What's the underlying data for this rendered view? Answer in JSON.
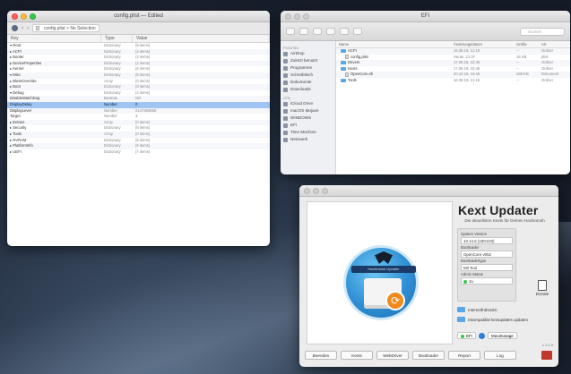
{
  "plist": {
    "title": "config.plist — Edited",
    "path": "config.plist  >  No Selection",
    "columns": [
      "Key",
      "Type",
      "Value"
    ],
    "rows": [
      {
        "key": "▾ Root",
        "type": "Dictionary",
        "value": "(9 items)"
      },
      {
        "key": "   ▸ ACPI",
        "type": "Dictionary",
        "value": "(4 items)"
      },
      {
        "key": "   ▸ Booter",
        "type": "Dictionary",
        "value": "(3 items)"
      },
      {
        "key": "   ▸ DeviceProperties",
        "type": "Dictionary",
        "value": "(2 items)"
      },
      {
        "key": "   ▸ Kernel",
        "type": "Dictionary",
        "value": "(6 items)"
      },
      {
        "key": "   ▾ Misc",
        "type": "Dictionary",
        "value": "(6 items)"
      },
      {
        "key": "      ▸ BlessOverride",
        "type": "Array",
        "value": "(0 items)"
      },
      {
        "key": "      ▸ Boot",
        "type": "Dictionary",
        "value": "(9 items)"
      },
      {
        "key": "      ▾ Debug",
        "type": "Dictionary",
        "value": "(4 items)"
      },
      {
        "key": "         DisableWatchDog",
        "type": "Boolean",
        "value": "NO"
      },
      {
        "key": "         DisplayDelay",
        "type": "Number",
        "value": "0"
      },
      {
        "key": "         DisplayLevel",
        "type": "Number",
        "value": "2147483650"
      },
      {
        "key": "         Target",
        "type": "Number",
        "value": "3"
      },
      {
        "key": "      ▸ Entries",
        "type": "Array",
        "value": "(0 items)"
      },
      {
        "key": "      ▸ Security",
        "type": "Dictionary",
        "value": "(8 items)"
      },
      {
        "key": "      ▸ Tools",
        "type": "Array",
        "value": "(0 items)"
      },
      {
        "key": "   ▸ NVRAM",
        "type": "Dictionary",
        "value": "(6 items)"
      },
      {
        "key": "   ▸ PlatformInfo",
        "type": "Dictionary",
        "value": "(6 items)"
      },
      {
        "key": "   ▸ UEFI",
        "type": "Dictionary",
        "value": "(7 items)"
      }
    ],
    "selected_index": 10
  },
  "finder": {
    "title": "EFI",
    "search_placeholder": "Suchen",
    "sidebar": [
      {
        "header": "Favoriten",
        "items": [
          "AirDrop",
          "Zuletzt benutzt",
          "Programme",
          "Schreibtisch",
          "Dokumente",
          "Downloads"
        ]
      },
      {
        "header": "Orte",
        "items": [
          "iCloud Drive",
          "macOS Mojave",
          "WINDOWS",
          "EFI",
          "Time Machine",
          "Netzwerk"
        ]
      }
    ],
    "columns": [
      "Name",
      "Änderungsdatum",
      "Größe",
      "Art"
    ],
    "rows": [
      {
        "name": "ACPI",
        "date": "16.08.19, 21:19",
        "size": "--",
        "kind": "Ordner",
        "folder": true,
        "indent": 1
      },
      {
        "name": "config.plist",
        "date": "Heute, 21:37",
        "size": "16 KB",
        "kind": "plist",
        "folder": false,
        "indent": 2
      },
      {
        "name": "Drivers",
        "date": "17.08.19, 22:46",
        "size": "--",
        "kind": "Ordner",
        "folder": true,
        "indent": 1
      },
      {
        "name": "Kexts",
        "date": "17.08.19, 22:46",
        "size": "--",
        "kind": "Ordner",
        "folder": true,
        "indent": 1
      },
      {
        "name": "OpenCore.efi",
        "date": "20.10.19, 16:49",
        "size": "268 KB",
        "kind": "Dokument",
        "folder": false,
        "indent": 2
      },
      {
        "name": "Tools",
        "date": "16.08.19, 21:19",
        "size": "--",
        "kind": "Ordner",
        "folder": true,
        "indent": 1
      }
    ]
  },
  "kext": {
    "title": "Kext Updater",
    "subtitle": "Die aktuellsten Kexts für Deinen Hackintosh",
    "logo_banner": "Hackintosh Updater",
    "info": [
      {
        "label": "System Version",
        "value": "10.14.6 (18G103)"
      },
      {
        "label": "Bootloader",
        "value": "OpenCore v052"
      },
      {
        "label": "Bootloadertype",
        "value": "Mit Tool"
      },
      {
        "label": "Admin Status",
        "value": "Ja",
        "dot": true
      }
    ],
    "donate_label": "Donate",
    "checks": [
      "Internetfrühzeitzi",
      "Inkompatible kextupdates updaten"
    ],
    "efi_label": "EFI",
    "mount_label": "Mountusage",
    "version": "v 3.1.9",
    "buttons": [
      "Beenden",
      "Kexts",
      "WebDriver",
      "Bootloader",
      "Report",
      "Log"
    ],
    "colors": {
      "accent": "#2f8fd4",
      "status_ok": "#34c84a"
    }
  }
}
